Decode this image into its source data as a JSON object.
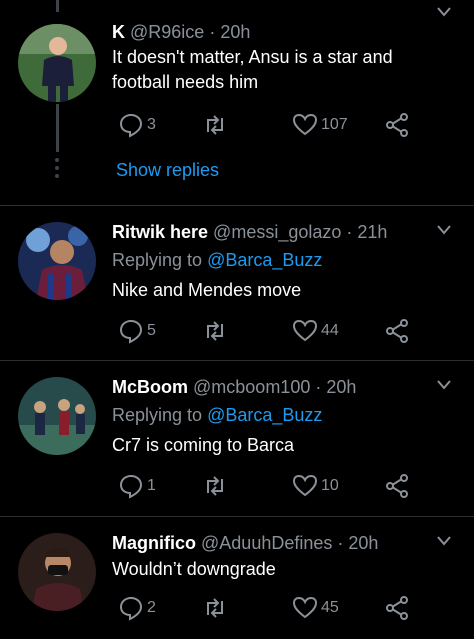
{
  "tweets": [
    {
      "name": "K",
      "handle": "@R96ice",
      "time": "· 20h",
      "text": "It doesn't matter, Ansu is a star and football needs him",
      "replies": "3",
      "likes": "107",
      "show_replies": "Show replies"
    },
    {
      "name": "Ritwik here",
      "handle": "@messi_golazo",
      "time": "· 21h",
      "replying_prefix": "Replying to",
      "replying_to": "@Barca_Buzz",
      "text": "Nike and Mendes move",
      "replies": "5",
      "likes": "44"
    },
    {
      "name": "McBoom",
      "handle": "@mcboom100",
      "time": "· 20h",
      "replying_prefix": "Replying to",
      "replying_to": "@Barca_Buzz",
      "text": "Cr7 is coming to Barca",
      "replies": "1",
      "likes": "10"
    },
    {
      "name": "Magnifico",
      "handle": "@AduuhDefines",
      "time": "· 20h",
      "text": "Wouldn’t downgrade",
      "replies": "2",
      "likes": "45"
    }
  ],
  "colors": {
    "accent": "#1d9bf0",
    "muted": "#8b9198",
    "background": "#000000"
  }
}
